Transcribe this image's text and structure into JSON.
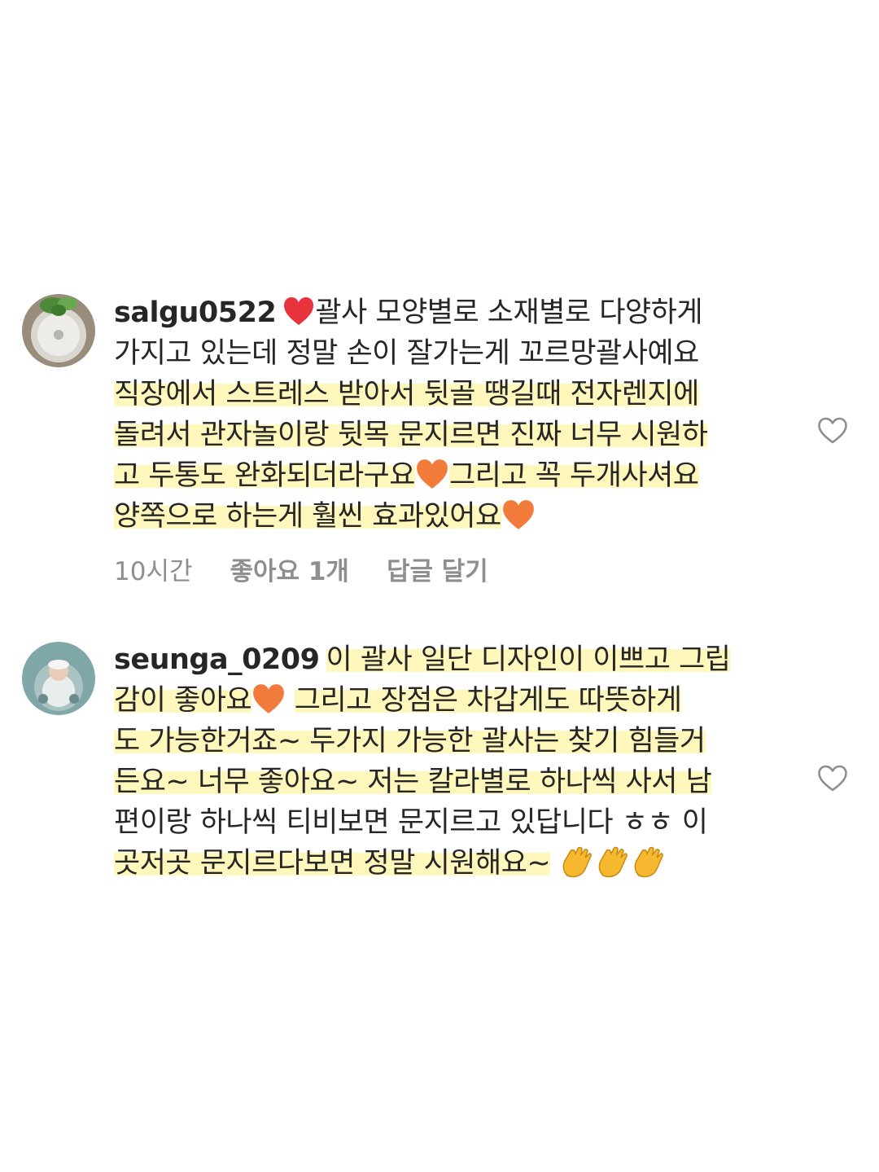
{
  "comments": [
    {
      "username": "salgu0522",
      "avatar_icon": "plant-avatar",
      "lines": [
        "괄사 모양별로 소재별로 다양하게",
        "가지고 있는데 정말 손이 잘가는게 꼬르망괄사예요",
        "직장에서 스트레스 받아서 뒷골 땡길때 전자렌지에",
        "돌려서 관자놀이랑 뒷목 문지르면 진짜 너무 시원하",
        "고 두통도 완화되더라구요",
        "그리고 꼭 두개사셔요",
        "양쪽으로 하는게 훨씬 효과있어요"
      ],
      "time": "10시간",
      "likes": "좋아요 1개",
      "reply": "답글 달기",
      "heart_color": "#e8323c"
    },
    {
      "username": "seunga_0209",
      "avatar_icon": "baby-avatar",
      "lines": [
        "이 괄사 일단 디자인이 이쁘고 그립",
        "감이 좋아요",
        "그리고 장점은 차갑게도 따뜻하게",
        "도 가능한거죠~ 두가지 가능한 괄사는 찾기 힘들거",
        "든요~ 너무 좋아요~ 저는 칼라별로 하나씩 사서 남",
        "편이랑 하나씩 티비보면 문지르고 있답니다 ㅎㅎ 이",
        "곳저곳 문지르다보면 정말 시원해요~"
      ],
      "heart_color": "#f27b3b"
    }
  ],
  "icons": {
    "like": "heart-outline-icon",
    "red_heart": "red-heart-emoji",
    "orange_heart": "orange-heart-emoji",
    "clap": "clapping-hands-emoji"
  },
  "colors": {
    "highlight": "#fff6b0",
    "meta_gray": "#8e8e8e",
    "text": "#262626"
  }
}
